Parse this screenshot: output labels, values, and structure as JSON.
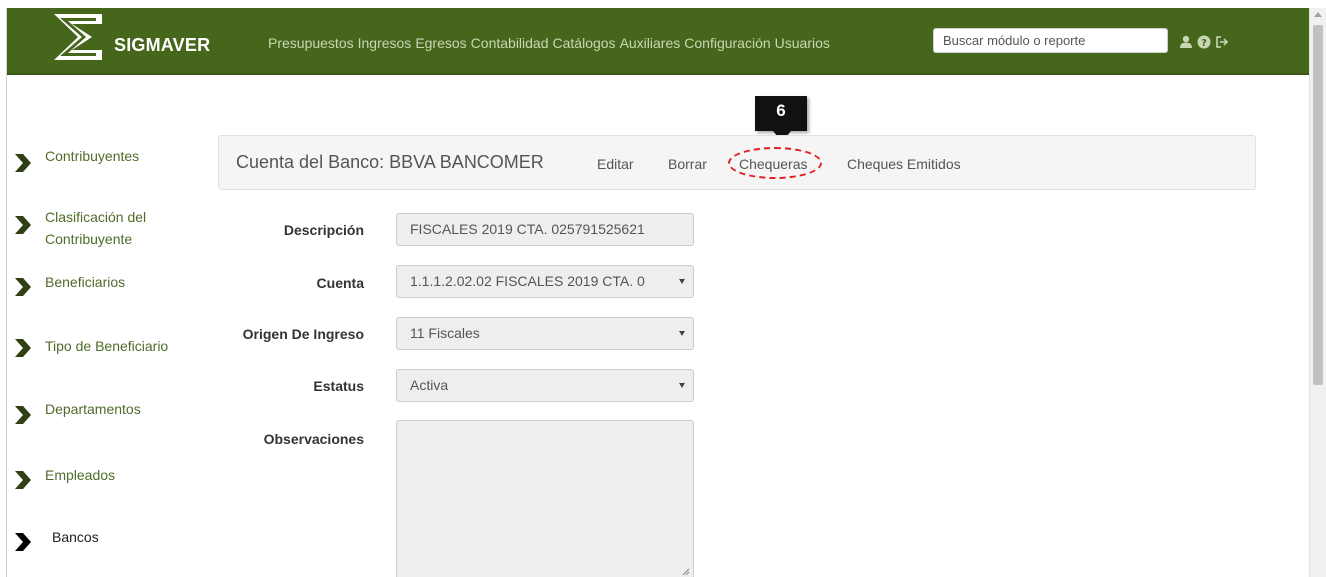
{
  "navbar": {
    "brand": "SIGMAVER",
    "links": [
      "Presupuestos",
      "Ingresos",
      "Egresos",
      "Contabilidad",
      "Catálogos",
      "Auxiliares",
      "Configuración",
      "Usuarios"
    ],
    "search_placeholder": "Buscar módulo o reporte",
    "icons": [
      "user-icon",
      "help-icon",
      "logout-icon"
    ],
    "color": "#46661c"
  },
  "sidebar": {
    "items": [
      {
        "label": "Contribuyentes"
      },
      {
        "label": "Clasificación del Contribuyente"
      },
      {
        "label": "Beneficiarios"
      },
      {
        "label": "Tipo de Beneficiario"
      },
      {
        "label": "Departamentos"
      },
      {
        "label": "Empleados"
      },
      {
        "label": "Bancos",
        "active": true
      }
    ]
  },
  "panel": {
    "title": "Cuenta del Banco: BBVA BANCOMER",
    "links": [
      "Editar",
      "Borrar",
      "Chequeras",
      "Cheques Emitidos"
    ],
    "highlighted_link": "Chequeras"
  },
  "callout": {
    "number": "6"
  },
  "form": {
    "descripcion_label": "Descripción",
    "descripcion_value": "FISCALES 2019 CTA. 025791525621",
    "cuenta_label": "Cuenta",
    "cuenta_value": "1.1.1.2.02.02 FISCALES 2019 CTA. 0",
    "origen_label": "Origen De Ingreso",
    "origen_value": "11 Fiscales",
    "estatus_label": "Estatus",
    "estatus_value": "Activa",
    "observaciones_label": "Observaciones",
    "observaciones_value": ""
  }
}
